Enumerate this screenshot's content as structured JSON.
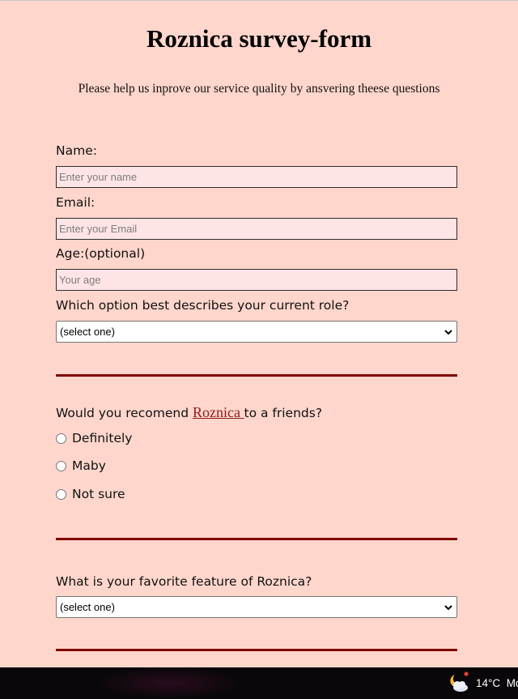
{
  "header": {
    "title": "Roznica survey-form",
    "description": "Please help us inprove our service quality by ansvering theese questions"
  },
  "form": {
    "name": {
      "label": "Name:",
      "placeholder": "Enter your name"
    },
    "email": {
      "label": "Email:",
      "placeholder": "Enter your Email"
    },
    "age": {
      "label": "Age:(optional)",
      "placeholder": "Your age"
    },
    "role": {
      "label": "Which option best describes your current role?",
      "selected": "(select one)"
    },
    "recommend": {
      "label_before": "Would you recomend ",
      "brand_link": "Roznica ",
      "label_after": "to a friends?",
      "options": [
        "Definitely",
        "Maby",
        "Not sure"
      ]
    },
    "feature": {
      "label": "What is your favorite feature of Roznica?",
      "selected": "(select one)"
    }
  },
  "taskbar": {
    "weather_icon": "partly-cloudy-night-icon",
    "temperature": "14°C",
    "weather_text": "Mo"
  },
  "colors": {
    "background": "#ffd6cc",
    "input_background": "#ffe4e6",
    "divider": "#800000",
    "link": "#8b1c1c",
    "taskbar": "#0a070a"
  }
}
